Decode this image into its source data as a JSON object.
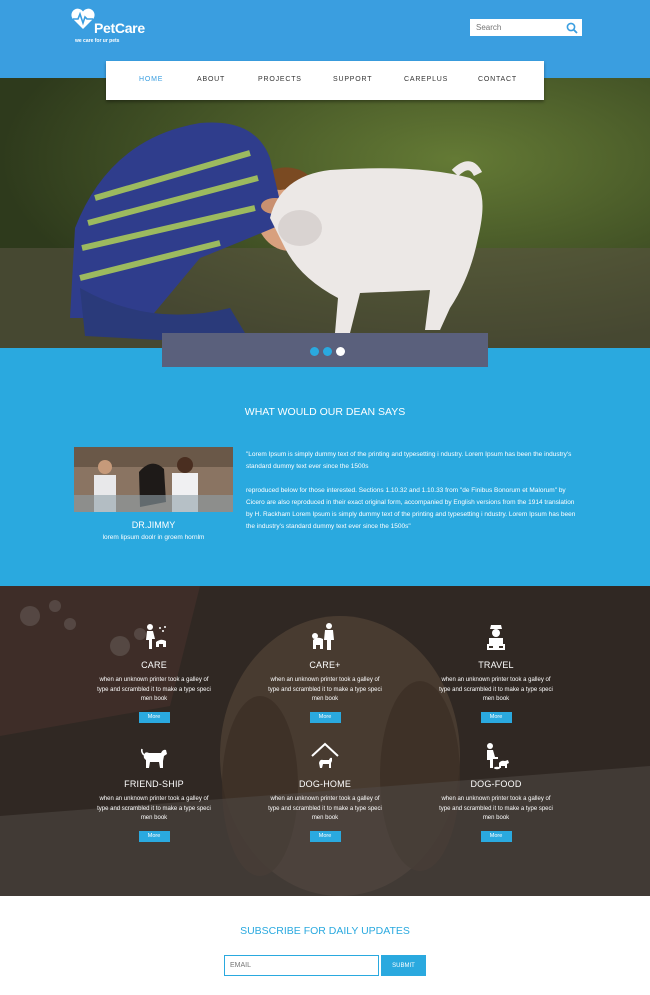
{
  "brand": {
    "name": "PetCare",
    "tagline": "we care for ur pets"
  },
  "search": {
    "placeholder": "Search"
  },
  "nav": {
    "items": [
      {
        "label": "HOME",
        "active": true
      },
      {
        "label": "ABOUT",
        "active": false
      },
      {
        "label": "PROJECTS",
        "active": false
      },
      {
        "label": "SUPPORT",
        "active": false
      },
      {
        "label": "CAREPLUS",
        "active": false
      },
      {
        "label": "CONTACT",
        "active": false
      }
    ]
  },
  "slider": {
    "dots": 3,
    "active_dot": 3
  },
  "dean": {
    "title": "WHAT WOULD OUR DEAN SAYS",
    "name": "DR.JIMMY",
    "role": "lorem lipsum doolr in groem hornlm",
    "quote_1": "\"Lorem Ipsum is simply dummy text of the printing and typesetting i ndustry. Lorem Ipsum has been the industry's standard dummy text ever since the 1500s",
    "quote_2": "reproduced below for those interested. Sections 1.10.32 and 1.10.33 from \"de Finibus Bonorum et Malorum\" by Cicero are also reproduced in their exact original form, accompanied by English versions from the 1914 translation by H. Rackham Lorem Ipsum is simply dummy text of the printing and typesetting i ndustry. Lorem Ipsum has been the industry's standard dummy text ever since the 1500s\""
  },
  "services": [
    {
      "title": "CARE",
      "icon": "pet-care-icon",
      "desc": "when an unknown printer took a galley of type and scrambled it to make a type speci men book",
      "button": "More"
    },
    {
      "title": "CARE+",
      "icon": "pet-training-icon",
      "desc": "when an unknown printer took a galley of type and scrambled it to make a type speci men book",
      "button": "More"
    },
    {
      "title": "TRAVEL",
      "icon": "travel-icon",
      "desc": "when an unknown printer took a galley of type and scrambled it to make a type speci men book",
      "button": "More"
    },
    {
      "title": "FRIEND-SHIP",
      "icon": "dog-icon",
      "desc": "when an unknown printer took a galley of type and scrambled it to make a type speci men book",
      "button": "More"
    },
    {
      "title": "DOG-HOME",
      "icon": "dog-home-icon",
      "desc": "when an unknown printer took a galley of type and scrambled it to make a type speci men book",
      "button": "More"
    },
    {
      "title": "DOG-FOOD",
      "icon": "dog-food-icon",
      "desc": "when an unknown printer took a galley of type and scrambled it to make a type speci men book",
      "button": "More"
    }
  ],
  "subscribe": {
    "title": "SUBSCRIBE FOR DAILY UPDATES",
    "placeholder": "EMAIL",
    "button": "SUBMIT"
  },
  "colors": {
    "header": "#3a9ee0",
    "accent": "#2aa9df",
    "slider_bar": "#5a607c"
  }
}
